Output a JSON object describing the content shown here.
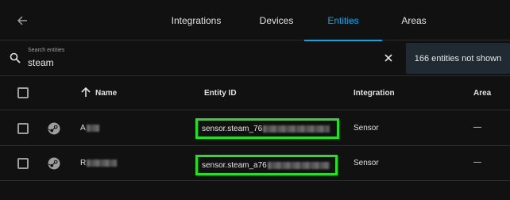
{
  "tabs": [
    {
      "label": "Integrations"
    },
    {
      "label": "Devices"
    },
    {
      "label": "Entities",
      "active": true
    },
    {
      "label": "Areas"
    }
  ],
  "search": {
    "label": "Search entities",
    "value": "steam"
  },
  "not_shown": "166 entities not shown",
  "columns": {
    "name": "Name",
    "entity_id": "Entity ID",
    "integration": "Integration",
    "area": "Area"
  },
  "rows": [
    {
      "name": "A",
      "entity_id": "sensor.steam_76",
      "integration": "Sensor",
      "area": "—"
    },
    {
      "name": "R",
      "entity_id": "sensor.steam_a76",
      "integration": "Sensor",
      "area": "—"
    }
  ],
  "colors": {
    "accent": "#03a9f4",
    "highlight": "#22e022",
    "background": "#111111"
  }
}
